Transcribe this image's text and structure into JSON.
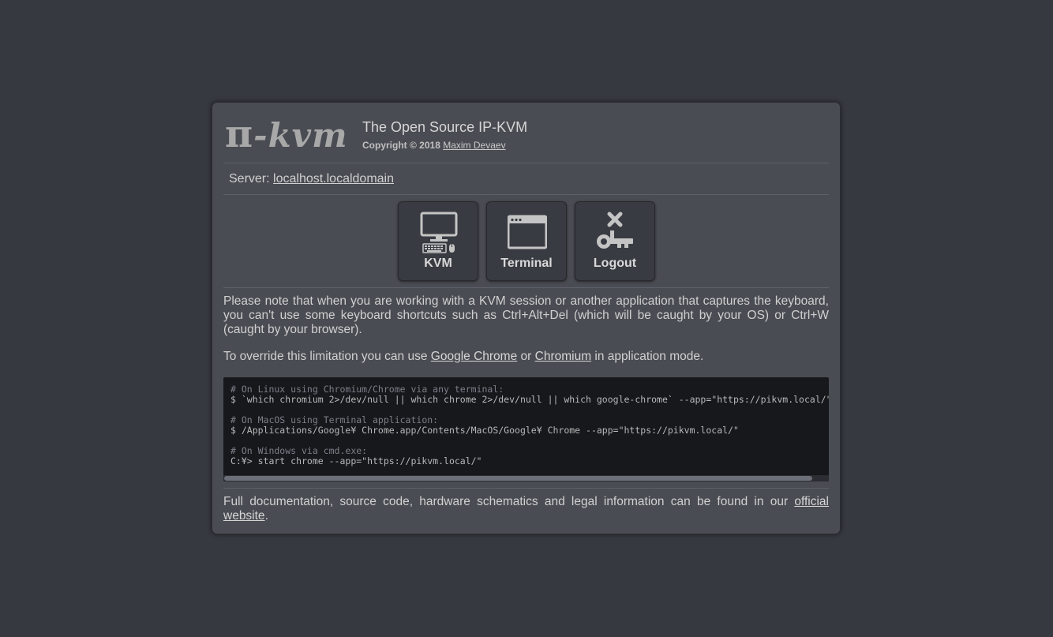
{
  "header": {
    "logo_pi": "π",
    "logo_text": "-kvm",
    "title": "The Open Source IP-KVM",
    "copyright_prefix": "Copyright © 2018",
    "author": "Maxim Devaev"
  },
  "server": {
    "label": "Server:",
    "host": "localhost.localdomain"
  },
  "buttons": {
    "kvm": "KVM",
    "terminal": "Terminal",
    "logout": "Logout"
  },
  "note": {
    "text": "Please note that when you are working with a KVM session or another application that captures the keyboard, you can't use some keyboard shortcuts such as Ctrl+Alt+Del (which will be caught by your OS) or Ctrl+W (caught by your browser).",
    "override_prefix": "To override this limitation you can use",
    "chrome_link": "Google Chrome",
    "or": "or",
    "chromium_link": "Chromium",
    "override_suffix": "in application mode."
  },
  "code": {
    "linux_comment": "# On Linux using Chromium/Chrome via any terminal:",
    "linux_cmd": "$ `which chromium 2>/dev/null || which chrome 2>/dev/null || which google-chrome` --app=\"https://pikvm.local/\"",
    "mac_comment": "# On MacOS using Terminal application:",
    "mac_cmd": "$ /Applications/Google¥ Chrome.app/Contents/MacOS/Google¥ Chrome --app=\"https://pikvm.local/\"",
    "win_comment": "# On Windows via cmd.exe:",
    "win_cmd": "C:¥> start chrome --app=\"https://pikvm.local/\""
  },
  "footer": {
    "text": "Full documentation, source code, hardware schematics and legal information can be found in our",
    "link_word1": "official",
    "link_word2": "website",
    "suffix": "."
  },
  "colors": {
    "background": "#363940",
    "panel": "#4a4c53",
    "tile": "#393b42",
    "code_bg": "#17181c"
  }
}
